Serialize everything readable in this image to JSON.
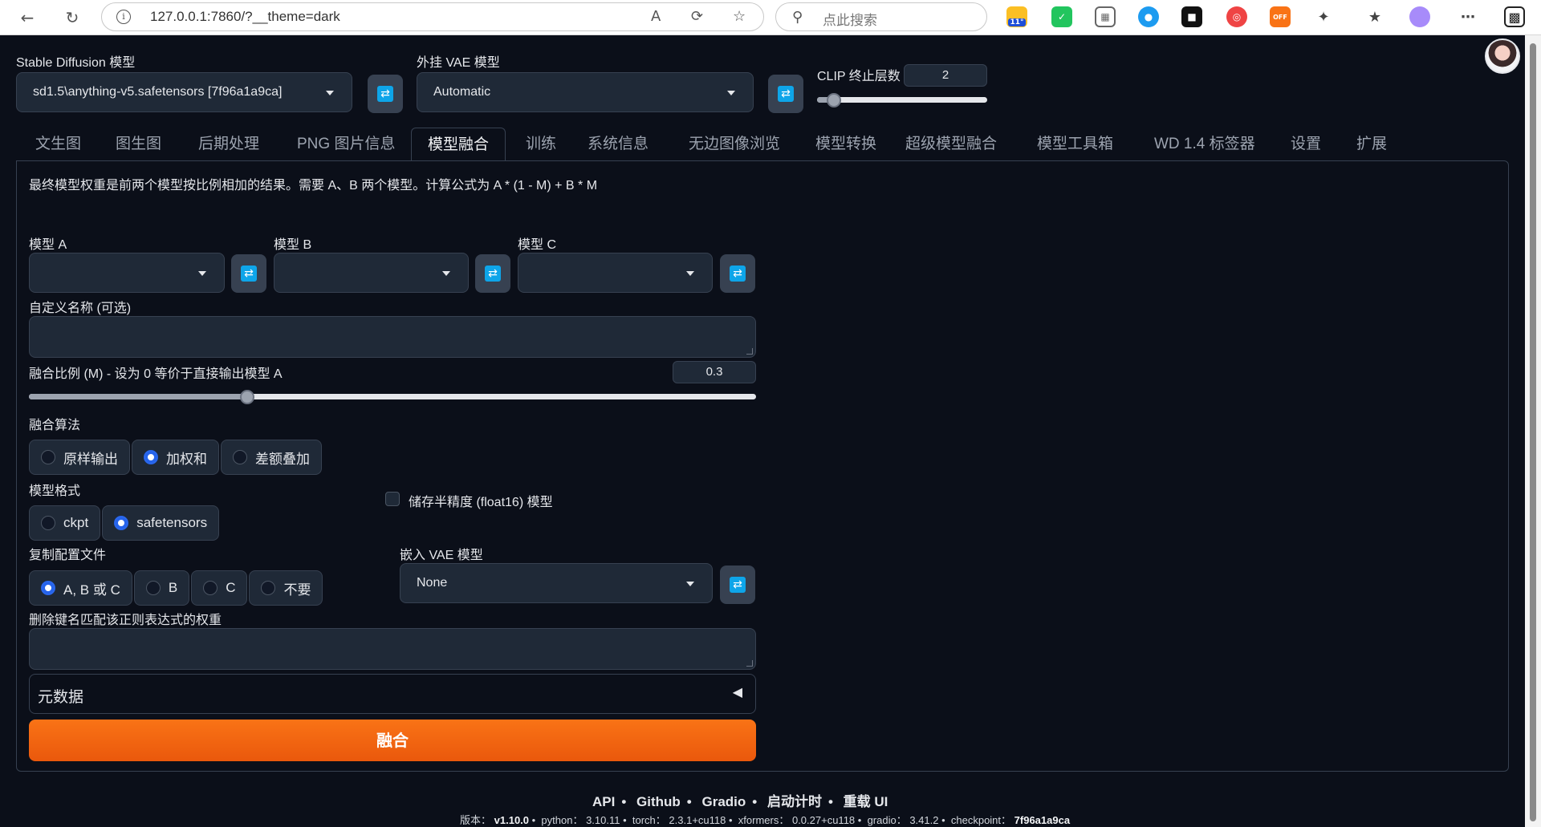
{
  "browser": {
    "url": "127.0.0.1:7860/?__theme=dark",
    "search_placeholder": "点此搜索",
    "weather_badge": "11°",
    "off_badge": "OFF"
  },
  "top": {
    "sd_model_label": "Stable Diffusion 模型",
    "sd_model_value": "sd1.5\\anything-v5.safetensors [7f96a1a9ca]",
    "vae_label": "外挂 VAE 模型",
    "vae_value": "Automatic",
    "clip_label": "CLIP 终止层数",
    "clip_value": "2",
    "clip_fraction": 0.1
  },
  "tabs": [
    {
      "label": "文生图"
    },
    {
      "label": "图生图"
    },
    {
      "label": "后期处理"
    },
    {
      "label": "PNG 图片信息"
    },
    {
      "label": "模型融合"
    },
    {
      "label": "训练"
    },
    {
      "label": "系统信息"
    },
    {
      "label": "无边图像浏览"
    },
    {
      "label": "模型转换"
    },
    {
      "label": "超级模型融合"
    },
    {
      "label": "模型工具箱"
    },
    {
      "label": "WD 1.4 标签器"
    },
    {
      "label": "设置"
    },
    {
      "label": "扩展"
    }
  ],
  "merge": {
    "description": "最终模型权重是前两个模型按比例相加的结果。需要 A、B 两个模型。计算公式为 A * (1 - M) + B * M",
    "model_a_label": "模型 A",
    "model_b_label": "模型 B",
    "model_c_label": "模型 C",
    "custom_name_label": "自定义名称 (可选)",
    "ratio_label": "融合比例 (M) - 设为 0 等价于直接输出模型 A",
    "ratio_value": "0.3",
    "ratio_fraction": 0.3,
    "algo_label": "融合算法",
    "algo_options": [
      "原样输出",
      "加权和",
      "差额叠加"
    ],
    "format_label": "模型格式",
    "format_options": [
      "ckpt",
      "safetensors"
    ],
    "half_label": "储存半精度 (float16) 模型",
    "copy_config_label": "复制配置文件",
    "copy_config_options": [
      "A, B 或 C",
      "B",
      "C",
      "不要"
    ],
    "bake_vae_label": "嵌入 VAE 模型",
    "bake_vae_value": "None",
    "discard_label": "删除键名匹配该正则表达式的权重",
    "metadata_label": "元数据",
    "merge_button": "融合"
  },
  "footer": {
    "links": [
      "API",
      "Github",
      "Gradio",
      "启动计时",
      "重载 UI"
    ],
    "version_prefix": "版本：",
    "version": "v1.10.0",
    "python_prefix": "python：",
    "python": "3.10.11",
    "torch_prefix": "torch：",
    "torch": "2.3.1+cu118",
    "xformers_prefix": "xformers：",
    "xformers": "0.0.27+cu118",
    "gradio_prefix": "gradio：",
    "gradio": "3.41.2",
    "checkpoint_prefix": "checkpoint：",
    "checkpoint": "7f96a1a9ca"
  }
}
